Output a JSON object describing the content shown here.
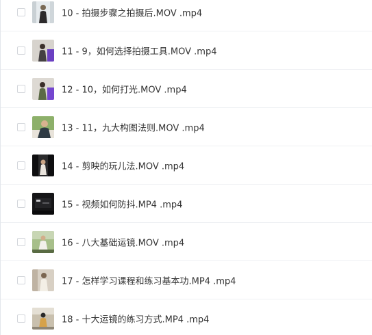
{
  "files": [
    {
      "name": "10 - 拍摄步骤之拍摄后.MOV .mp4",
      "thumb": "bright-portrait",
      "colors": [
        "#e6ebee",
        "#7a6a56",
        "#2d2b2c"
      ]
    },
    {
      "name": "11 - 9，如何选择拍摄工具.MOV .mp4",
      "thumb": "purple-portrait",
      "colors": [
        "#d7d3cd",
        "#444042",
        "#6b40c2"
      ]
    },
    {
      "name": "12 - 10，如何打光.MOV .mp4",
      "thumb": "purple-portrait",
      "colors": [
        "#ddd9d3",
        "#5b6a45",
        "#7446cf"
      ]
    },
    {
      "name": "13 - 11，九大构图法则.MOV .mp4",
      "thumb": "garden-portrait",
      "colors": [
        "#8db06a",
        "#2f3b44",
        "#e8e3da"
      ]
    },
    {
      "name": "14 - 剪映的玩儿法.MOV .mp4",
      "thumb": "dark-portrait",
      "colors": [
        "#0e0e10",
        "#e9e4dd",
        "#1a1a1c"
      ]
    },
    {
      "name": "15 - 视频如何防抖.MP4 .mp4",
      "thumb": "dark-scene",
      "colors": [
        "#151517",
        "#5a5a5e",
        "#c9c9cc"
      ]
    },
    {
      "name": "16 - 八大基础运镜.MOV .mp4",
      "thumb": "garden-white",
      "colors": [
        "#a7bf8a",
        "#f2f0eb",
        "#596b43"
      ]
    },
    {
      "name": "17 - 怎样学习课程和练习基本功.MP4 .mp4",
      "thumb": "room-portrait",
      "colors": [
        "#d8d0c4",
        "#f3efe6",
        "#7b6651"
      ]
    },
    {
      "name": "18 - 十大运镜的练习方式.MP4 .mp4",
      "thumb": "outdoor-portrait",
      "colors": [
        "#c9c0ae",
        "#2a2a2a",
        "#d6a24a"
      ]
    }
  ]
}
